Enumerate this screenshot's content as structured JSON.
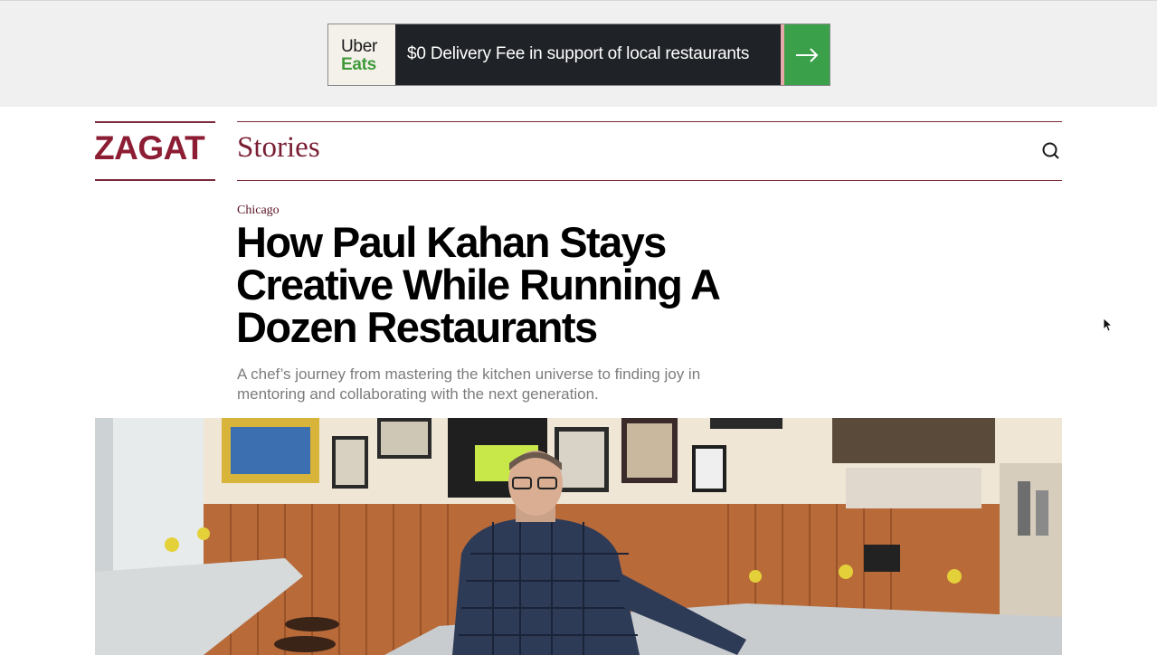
{
  "ad": {
    "brand_line1": "Uber",
    "brand_line2": "Eats",
    "text": "$0 Delivery Fee in support of local restaurants",
    "arrow_icon": "arrow-right-icon",
    "brand_color": "#3f9b3a"
  },
  "header": {
    "logo": "ZAGAT",
    "section": "Stories",
    "search_icon": "search-icon",
    "accent_color": "#8c1d33"
  },
  "article": {
    "kicker": "Chicago",
    "headline": "How Paul Kahan Stays Creative While Running A Dozen Restaurants",
    "dek": "A chef’s journey from mastering the kitchen universe to finding joy in mentoring and collaborating with the next generation."
  },
  "hero_image": {
    "description_icon": "hero-photo"
  }
}
